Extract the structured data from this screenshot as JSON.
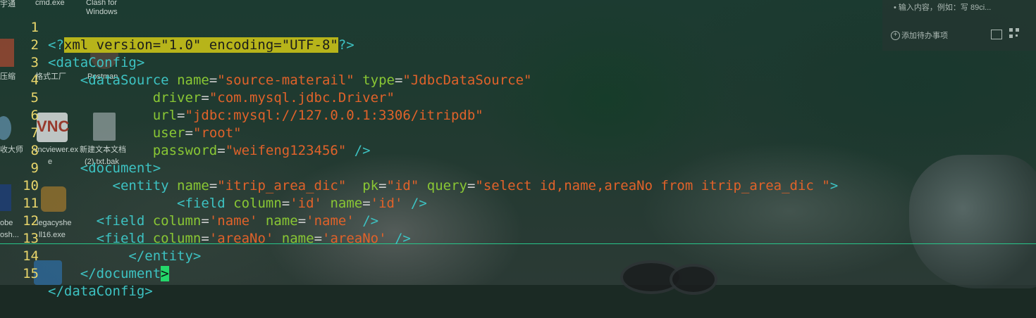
{
  "desktop": {
    "top_left_label": "宇通",
    "cmd_label": "cmd.exe",
    "clash_label": "Clash for Windows",
    "left_label_1": "压缩",
    "format_factory_label": "格式工厂",
    "postman_label": "Postman",
    "vnc_glyph": "VNC",
    "master_label": "收大师",
    "vncviewer_label_1": "vncviewer.ex",
    "vncviewer_label_2": "e",
    "textfile_label_1": "新建文本文档",
    "textfile_label_2": "(2).txt.bak",
    "legacy_label_1": "legacyshe",
    "legacy_label_2": "ll16.exe",
    "adobe_label_1": "obe",
    "adobe_label_2": "osh..."
  },
  "todo_widget": {
    "input_hint": "• 输入内容，例如：写 89ci...",
    "add_label": "添加待办事项"
  },
  "editor": {
    "lines": [
      {
        "n": "1"
      },
      {
        "n": "2"
      },
      {
        "n": "3"
      },
      {
        "n": "4"
      },
      {
        "n": "5"
      },
      {
        "n": "6"
      },
      {
        "n": "7"
      },
      {
        "n": "8"
      },
      {
        "n": "9"
      },
      {
        "n": "10"
      },
      {
        "n": "11"
      },
      {
        "n": "12"
      },
      {
        "n": "13"
      },
      {
        "n": "14"
      },
      {
        "n": "15"
      }
    ],
    "xml_decl_open": "<?",
    "xml_decl_body": "xml version=\"1.0\" encoding=\"UTF-8\"",
    "xml_decl_close": "?>",
    "dataConfig_open": "<dataConfig>",
    "ds_tag": "<dataSource",
    "ds_name_attr": "name",
    "ds_name_val": "\"source-materail\"",
    "ds_type_attr": "type",
    "ds_type_val": "\"JdbcDataSource\"",
    "driver_attr": "driver",
    "driver_val": "\"com.mysql.jdbc.Driver\"",
    "url_attr": "url",
    "url_val": "\"jdbc:mysql://127.0.0.1:3306/itripdb\"",
    "user_attr": "user",
    "user_val": "\"root\"",
    "password_attr": "password",
    "password_val": "\"weifeng123456\"",
    "selfclose": "/>",
    "document_open": "<document>",
    "entity_tag": "<entity",
    "entity_name_attr": "name",
    "entity_name_val": "\"itrip_area_dic\"",
    "entity_pk_attr": "pk",
    "entity_pk_val": "\"id\"",
    "entity_query_attr": "query",
    "entity_query_val": "\"select id,name,areaNo from itrip_area_dic \"",
    "gt": ">",
    "field_tag": "<field",
    "column_attr": "column",
    "name_attr": "name",
    "f1_col": "'id'",
    "f1_name": "'id'",
    "f2_col": "'name'",
    "f2_name": "'name'",
    "f3_col": "'areaNo'",
    "f3_name": "'areaNo'",
    "entity_close": "</entity>",
    "document_close_body": "</document",
    "cursor_char": ">",
    "dataConfig_close": "</dataConfig>",
    "eq": "="
  }
}
